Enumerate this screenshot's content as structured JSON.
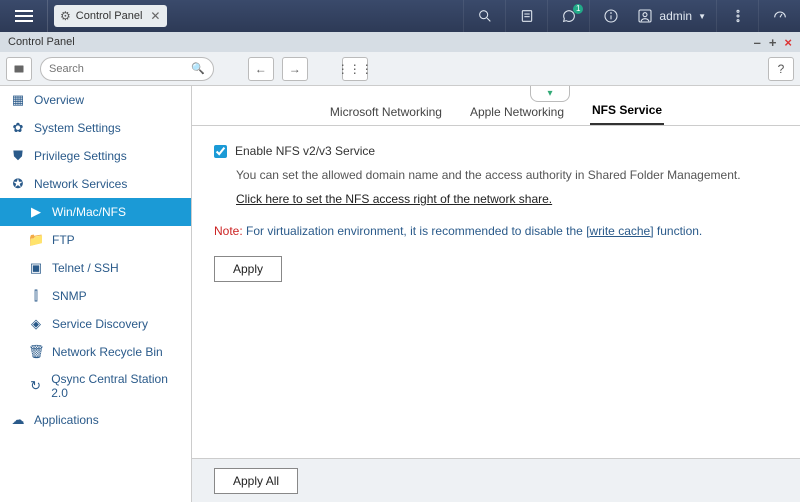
{
  "header": {
    "tab_title": "Control Panel",
    "notification_badge": "1",
    "username": "admin"
  },
  "window": {
    "title": "Control Panel"
  },
  "toolbar": {
    "search_placeholder": "Search"
  },
  "sidebar": {
    "items": [
      {
        "label": "Overview",
        "icon": "▦",
        "level": 1
      },
      {
        "label": "System Settings",
        "icon": "✿",
        "level": 1
      },
      {
        "label": "Privilege Settings",
        "icon": "⛊",
        "level": 1
      },
      {
        "label": "Network Services",
        "icon": "✪",
        "level": 1
      },
      {
        "label": "Win/Mac/NFS",
        "icon": "▶",
        "level": 2,
        "active": true
      },
      {
        "label": "FTP",
        "icon": "📁",
        "level": 2
      },
      {
        "label": "Telnet / SSH",
        "icon": "▣",
        "level": 2
      },
      {
        "label": "SNMP",
        "icon": "⫿",
        "level": 2
      },
      {
        "label": "Service Discovery",
        "icon": "◈",
        "level": 2
      },
      {
        "label": "Network Recycle Bin",
        "icon": "🗑",
        "level": 2
      },
      {
        "label": "Qsync Central Station 2.0",
        "icon": "↻",
        "level": 2
      },
      {
        "label": "Applications",
        "icon": "☁",
        "level": 1
      }
    ]
  },
  "tabs": {
    "items": [
      {
        "label": "Microsoft Networking"
      },
      {
        "label": "Apple Networking"
      },
      {
        "label": "NFS Service",
        "active": true
      }
    ]
  },
  "nfs": {
    "checkbox_label": "Enable NFS v2/v3 Service",
    "description": "You can set the allowed domain name and the access authority in Shared Folder Management.",
    "access_link": "Click here to set the NFS access right of the network share.",
    "note_prefix": "Note:",
    "note_body_pre": " For virtualization environment, it is recommended to disable the ",
    "note_link": "[write cache]",
    "note_body_post": " function.",
    "apply_label": "Apply"
  },
  "footer": {
    "apply_all_label": "Apply All"
  }
}
